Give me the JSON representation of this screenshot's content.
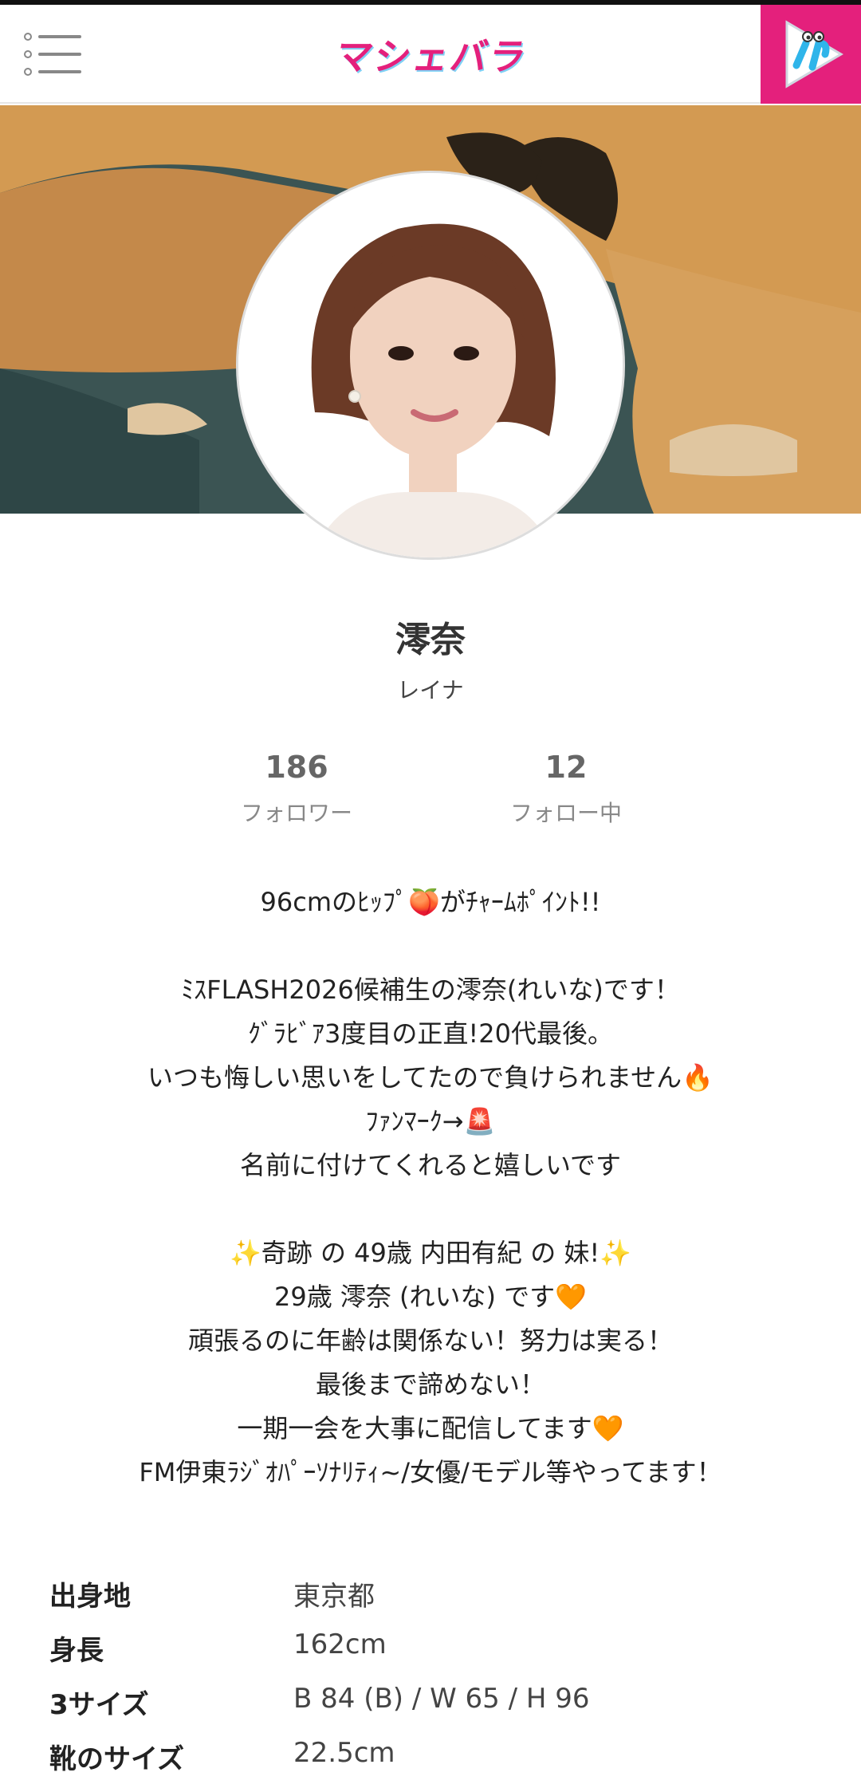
{
  "header": {
    "logo_text": "マシェバラ",
    "menu_icon": "list-menu-icon",
    "app_icon": "play-app-icon",
    "accent_color": "#e4207c"
  },
  "profile": {
    "name": "澪奈",
    "kana": "レイナ",
    "followers": {
      "count": "186",
      "label": "フォロワー"
    },
    "following": {
      "count": "12",
      "label": "フォロー中"
    },
    "bio": "96cmのﾋｯﾌﾟ🍑がﾁｬｰﾑﾎﾟｲﾝﾄ!!\n\nﾐｽFLASH2026候補生の澪奈(れいな)です！\nｸﾞﾗﾋﾞｱ3度目の正直!20代最後。\nいつも悔しい思いをしてたので負けられません🔥\nﾌｧﾝﾏｰｸ→🚨\n名前に付けてくれると嬉しいです\n\n✨奇跡 の 49歳 内田有紀 の 妹!✨\n29歳 澪奈 (れいな) です🧡\n頑張るのに年齢は関係ない！努力は実る！\n最後まで諦めない！\n一期一会を大事に配信してます🧡\nFM伊東ﾗｼﾞｵﾊﾟｰｿﾅﾘﾃｨ~/女優/モデル等やってます！",
    "details": [
      {
        "key": "出身地",
        "value": "東京都"
      },
      {
        "key": "身長",
        "value": "162cm"
      },
      {
        "key": "3サイズ",
        "value": "B 84 (B) / W 65 / H 96"
      },
      {
        "key": "靴のサイズ",
        "value": "22.5cm"
      }
    ]
  }
}
